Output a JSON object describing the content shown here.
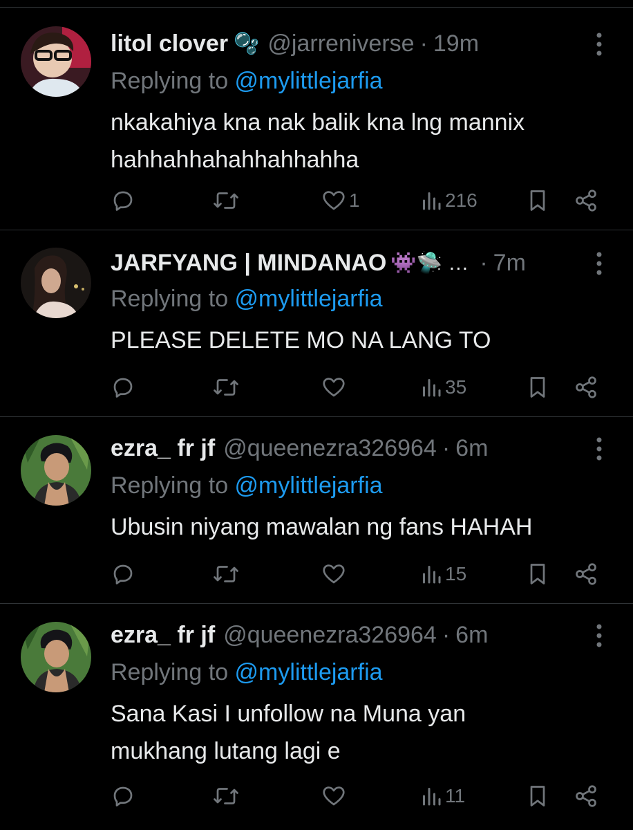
{
  "posts": [
    {
      "name": "litol clover",
      "badge": "🫧",
      "handle": "@jarreniverse",
      "dot": "·",
      "time": "19m",
      "replying_prefix": "Replying to ",
      "replying_to": "@mylittlejarfia",
      "body_lines": [
        "nkakahiya kna nak balik kna lng mannix",
        "hahhahhahahhahhahha"
      ],
      "likes": "1",
      "views": "216"
    },
    {
      "name": "JARFYANG | MINDANAO",
      "badge": "👾🛸 …",
      "handle": "",
      "dot": "·",
      "time": "7m",
      "replying_prefix": "Replying to ",
      "replying_to": "@mylittlejarfia",
      "body_lines": [
        "PLEASE DELETE MO NA LANG TO"
      ],
      "likes": "",
      "views": "35"
    },
    {
      "name": "ezra_ fr jf",
      "badge": "",
      "handle": "@queenezra326964",
      "dot": "·",
      "time": "6m",
      "replying_prefix": "Replying to ",
      "replying_to": "@mylittlejarfia",
      "body_lines": [
        "Ubusin niyang mawalan ng fans HAHAH"
      ],
      "likes": "",
      "views": "15"
    },
    {
      "name": "ezra_ fr jf",
      "badge": "",
      "handle": "@queenezra326964",
      "dot": "·",
      "time": "6m",
      "replying_prefix": "Replying to ",
      "replying_to": "@mylittlejarfia",
      "body_lines": [
        "Sana Kasi I unfollow na Muna yan",
        "mukhang lutang lagi e"
      ],
      "likes": "",
      "views": "11"
    }
  ],
  "icons": {
    "reply": "reply-icon",
    "repost": "repost-icon",
    "like": "heart-icon",
    "views": "views-icon",
    "bookmark": "bookmark-icon",
    "share": "share-icon",
    "more": "more-vertical-icon"
  },
  "colors": {
    "background": "#000000",
    "text": "#e7e9ea",
    "muted": "#71767b",
    "link": "#1d9bf0",
    "divider": "#2f3336"
  }
}
